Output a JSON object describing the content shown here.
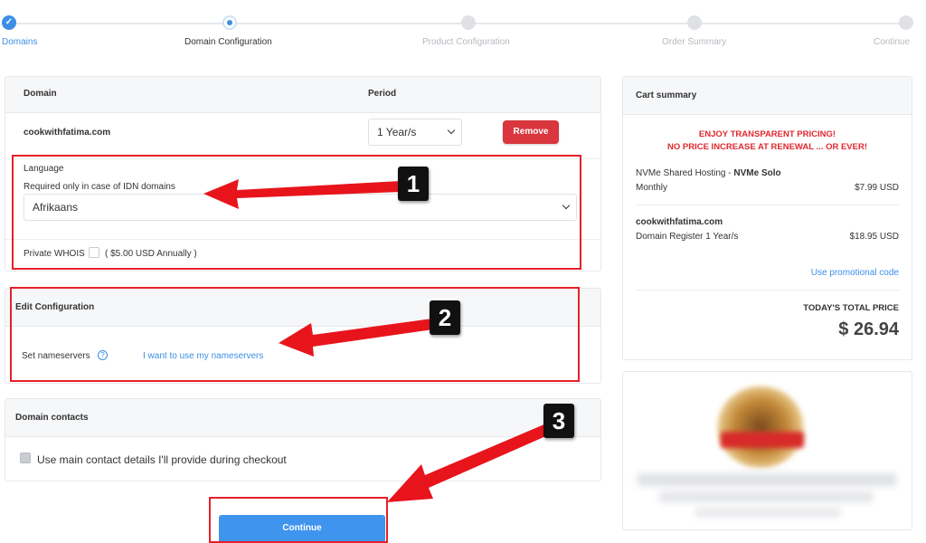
{
  "steps": [
    {
      "label": "Domains",
      "state": "done"
    },
    {
      "label": "Domain Configuration",
      "state": "active"
    },
    {
      "label": "Product Configuration",
      "state": "pending"
    },
    {
      "label": "Order Summary",
      "state": "pending"
    },
    {
      "label": "Continue",
      "state": "pending"
    }
  ],
  "domain_card": {
    "col_domain": "Domain",
    "col_period": "Period",
    "domain_name": "cookwithfatima.com",
    "period_value": "1 Year/s",
    "remove_label": "Remove",
    "language_label": "Language",
    "language_hint": "Required only in case of IDN domains",
    "language_value": "Afrikaans",
    "whois_label": "Private WHOIS",
    "whois_price": "( $5.00 USD Annually )"
  },
  "edit_config": {
    "title": "Edit Configuration",
    "nameservers_label": "Set nameservers",
    "help_glyph": "?",
    "nameservers_link": "I want to use my nameservers"
  },
  "contacts": {
    "title": "Domain contacts",
    "option_label": "Use main contact details I'll provide during checkout"
  },
  "continue_label": "Continue",
  "cart": {
    "title": "Cart summary",
    "promo_line1": "ENJOY TRANSPARENT PRICING!",
    "promo_line2": "NO PRICE INCREASE AT RENEWAL ... OR EVER!",
    "item1_name": "NVMe Shared Hosting - ",
    "item1_plan": "NVMe Solo",
    "item1_cycle": "Monthly",
    "item1_price": "$7.99 USD",
    "item2_name": "cookwithfatima.com",
    "item2_desc": "Domain Register 1 Year/s",
    "item2_price": "$18.95 USD",
    "promo_code_link": "Use promotional code",
    "total_label": "TODAY'S TOTAL PRICE",
    "total_value": "$ 26.94"
  },
  "annotations": [
    "1",
    "2",
    "3"
  ],
  "colors": {
    "accent": "#3d8ee6",
    "danger": "#d9363e",
    "arrow": "#e8141c"
  }
}
